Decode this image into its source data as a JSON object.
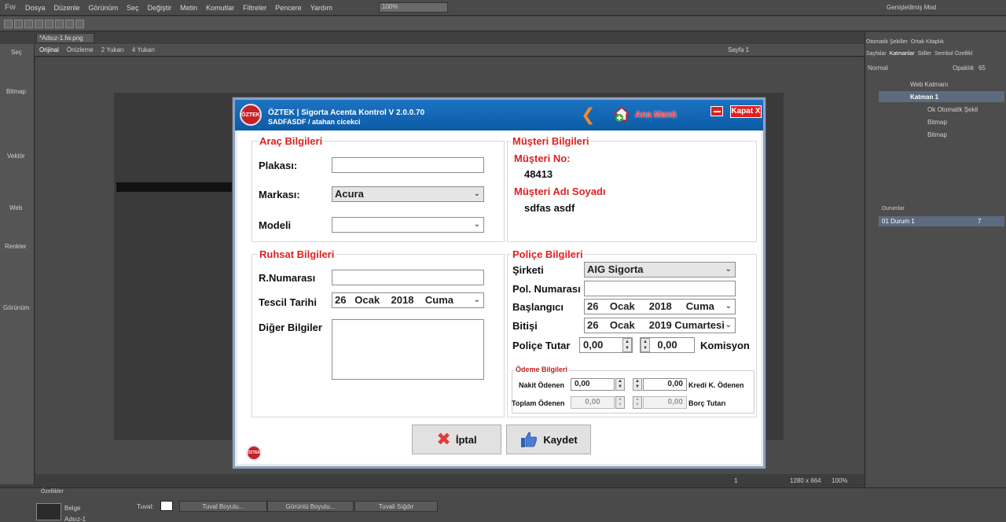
{
  "editor": {
    "menu": [
      "Dosya",
      "Düzenle",
      "Görünüm",
      "Seç",
      "Değiştir",
      "Metin",
      "Komutlar",
      "Filtreler",
      "Pencere",
      "Yardım"
    ],
    "zoom_field": "100%",
    "mode": "Genişletilmiş Mod",
    "doc_tab": "*Adsız-1.fw.png",
    "view_modes": [
      "Orijinal",
      "Önizleme",
      "2 Yukarı",
      "4 Yukarı"
    ],
    "page_label": "Sayfa 1",
    "tool_sections": [
      "Seç",
      "Bitmap",
      "Vektör",
      "Web",
      "Renkler",
      "Görünüm"
    ],
    "status_size": "1280 x 664",
    "status_zoom": "100%",
    "status_page": "1",
    "right_tabs1": [
      "Otomatik Şekiller",
      "Ortak Kitaplık"
    ],
    "right_tabs2": [
      "Sayfalar",
      "Katmanlar",
      "Stiller",
      "Sembol Özellikl"
    ],
    "blend": "Normal",
    "opacity_label": "Opaklık",
    "opacity_value": "65",
    "layers": [
      "Web Katmanı",
      "Katman 1",
      "Ok Otomatik Şekil",
      "Bitmap",
      "Bitmap"
    ],
    "states_tab": "Durumlar",
    "state_row": "01  Durum 1",
    "state_num": "7",
    "props_tab": "Özellikler",
    "props_doc": "Belge",
    "props_name": "Adsız-1",
    "canvas_label": "Tuval:",
    "props_buttons": [
      "Tuval Boyutu...",
      "Görüntü Boyutu...",
      "Tuvali Sığdır"
    ]
  },
  "dialog": {
    "title": "ÖZTEK | Sigorta Acenta Kontrol V 2.0.0.70",
    "subtitle": "SADFASDF / atahan cicekci",
    "logo_text": "ÖZTEK",
    "main_menu": "Ana Menü",
    "close": "Kapat X",
    "arac": {
      "title": "Araç Bilgileri",
      "plaka_label": "Plakası:",
      "plaka_value": "",
      "marka_label": "Markası:",
      "marka_value": "Acura",
      "model_label": "Modeli",
      "model_value": ""
    },
    "musteri": {
      "title": "Müşteri Bilgileri",
      "no_label": "Müşteri No:",
      "no_value": "48413",
      "ad_label": "Müşteri Adı Soyadı",
      "ad_value": "sdfas asdf"
    },
    "ruhsat": {
      "title": "Ruhsat Bilgileri",
      "no_label": "R.Numarası",
      "no_value": "",
      "tescil_label": "Tescil Tarihi",
      "tescil_value": "26   Ocak    2018    Cuma",
      "diger_label": "Diğer Bilgiler",
      "diger_value": ""
    },
    "police": {
      "title": "Poliçe Bilgileri",
      "sirket_label": "Şirketi",
      "sirket_value": "AIG Sigorta",
      "pol_no_label": "Pol. Numarası",
      "pol_no_value": "",
      "baslangic_label": "Başlangıcı",
      "baslangic_value": "26    Ocak     2018     Cuma",
      "bitis_label": "Bitişi",
      "bitis_value": "26    Ocak     2019 Cumartesi",
      "tutar_label": "Poliçe Tutar",
      "tutar_value": "0,00",
      "komisyon_value": "0,00",
      "komisyon_label": "Komisyon"
    },
    "odeme": {
      "title": "Ödeme Bilgileri",
      "nakit_label": "Nakit Ödenen",
      "nakit_value": "0,00",
      "kredi_value": "0,00",
      "kredi_label": "Kredi K. Ödenen",
      "toplam_label": "Toplam Ödenen",
      "toplam_value": "0,00",
      "borc_value": "0,00",
      "borc_label": "Borç Tutarı"
    },
    "cancel": "İptal",
    "save": "Kaydet"
  },
  "colors": {
    "accent_red": "#e02020",
    "title_blue": "#1d73c2"
  }
}
